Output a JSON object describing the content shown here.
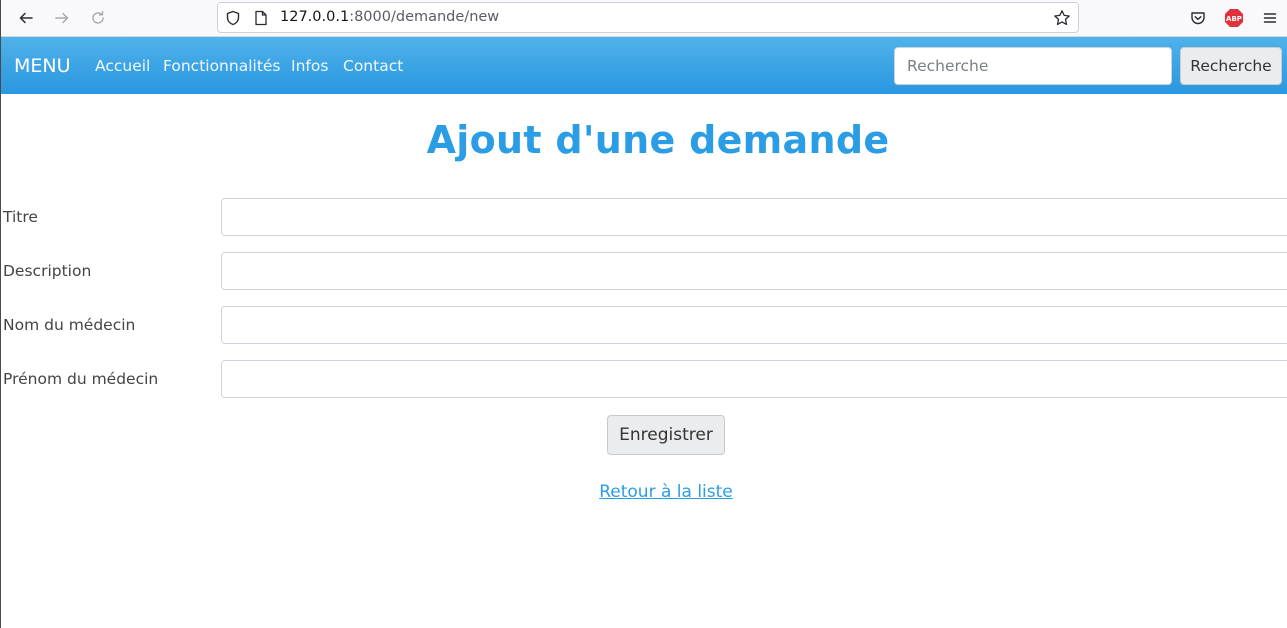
{
  "browser": {
    "url_host": "127.0.0.1",
    "url_rest": ":8000/demande/new",
    "icons": [
      "back-arrow-icon",
      "forward-arrow-icon",
      "reload-icon",
      "shield-icon",
      "page-icon",
      "bookmark-star-icon",
      "pocket-icon",
      "adblock-icon",
      "hamburger-menu-icon"
    ],
    "adblock_label": "ABP"
  },
  "navbar": {
    "brand": "MENU",
    "links": [
      "Accueil",
      "Fonctionnalités",
      "Infos",
      "Contact"
    ],
    "search_placeholder": "Recherche",
    "search_button": "Recherche",
    "color": "#2a97e0"
  },
  "main": {
    "title": "Ajout d'une demande",
    "fields": [
      {
        "label": "Titre",
        "value": ""
      },
      {
        "label": "Description",
        "value": ""
      },
      {
        "label": "Nom du médecin",
        "value": ""
      },
      {
        "label": "Prénom du médecin",
        "value": ""
      }
    ],
    "save_button": "Enregistrer",
    "back_link": "Retour à la liste",
    "accent_color": "#2b9de4"
  }
}
